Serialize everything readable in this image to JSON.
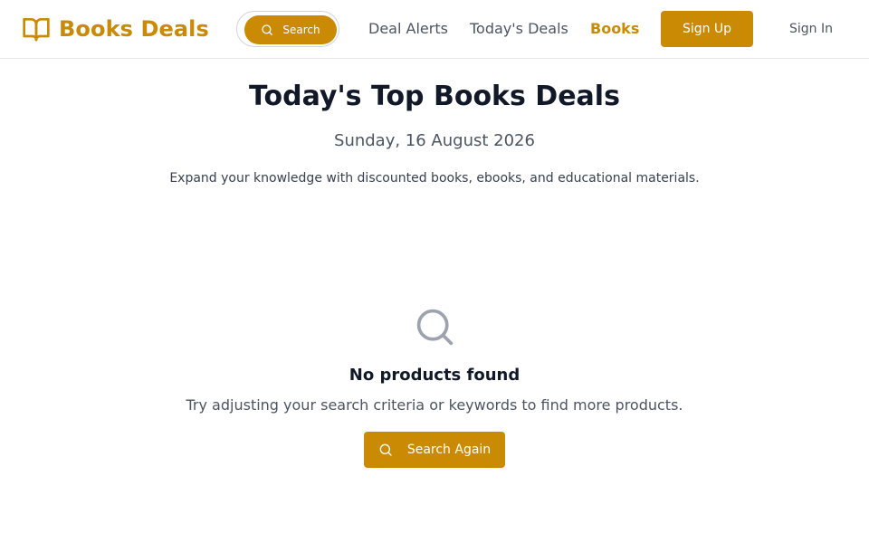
{
  "brand": {
    "name": "Books Deals",
    "icon": "open-book-icon",
    "accent_color": "#ca8a04"
  },
  "header": {
    "search_label": "Search",
    "search_icon": "search-icon",
    "nav": [
      {
        "label": "Deal Alerts",
        "active": false
      },
      {
        "label": "Today's Deals",
        "active": false
      },
      {
        "label": "Books",
        "active": true
      }
    ],
    "signup_label": "Sign Up",
    "signin_label": "Sign In"
  },
  "main": {
    "title": "Today's Top Books Deals",
    "date": "Sunday, 16 August 2026",
    "description": "Expand your knowledge with discounted books, ebooks, and educational materials."
  },
  "empty_state": {
    "icon": "search-icon",
    "title": "No products found",
    "message": "Try adjusting your search criteria or keywords to find more products.",
    "button_label": "Search Again",
    "button_icon": "search-icon"
  }
}
